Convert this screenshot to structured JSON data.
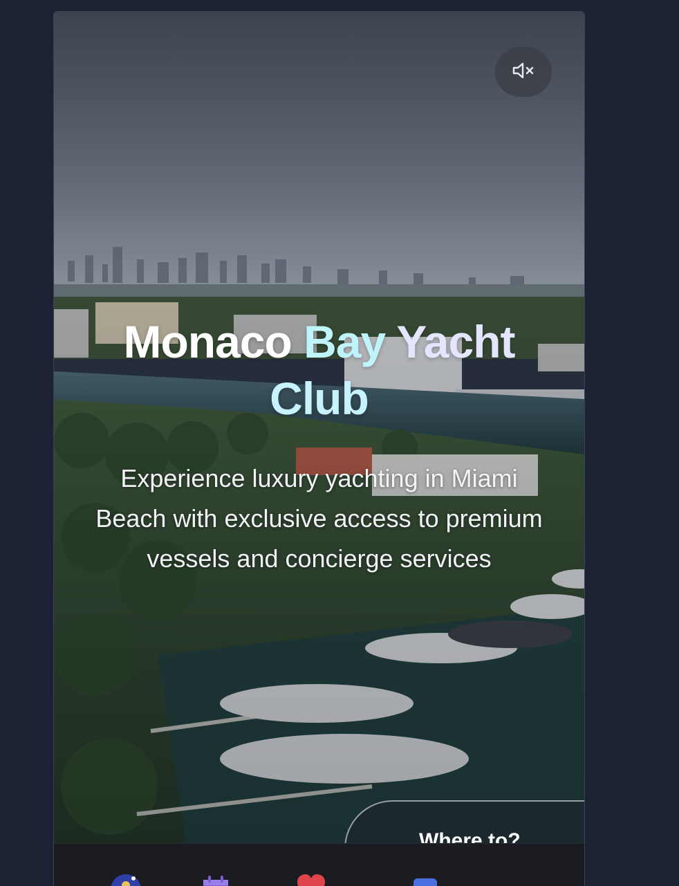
{
  "hero": {
    "title_words": [
      "Monaco",
      "Bay",
      "Yacht",
      "Club"
    ],
    "subtitle": "Experience luxury yachting in Miami Beach with exclusive access to premium vessels and concierge services",
    "mute_icon": "volume-mute-icon"
  },
  "search": {
    "label": "Where to?"
  },
  "nav": {
    "items": [
      {
        "icon": "profile-icon",
        "color": "#2f3fa8"
      },
      {
        "icon": "calendar-icon",
        "color": "#7b5cd6"
      },
      {
        "icon": "heart-icon",
        "color": "#e0454b"
      },
      {
        "icon": "messages-icon",
        "color": "#4a6fe0"
      }
    ]
  },
  "colors": {
    "page_bg": "#1c2233",
    "title_accent": "#bff4fb",
    "nav_bg": "#1b1c21"
  }
}
